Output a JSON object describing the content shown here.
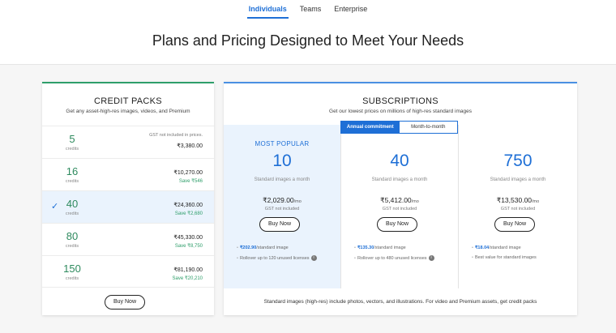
{
  "tabs": [
    {
      "label": "Individuals",
      "active": true
    },
    {
      "label": "Teams",
      "active": false
    },
    {
      "label": "Enterprise",
      "active": false
    }
  ],
  "page_title": "Plans and Pricing Designed to Meet Your Needs",
  "credit_packs": {
    "title": "CREDIT PACKS",
    "subtitle": "Get any asset-high-res images, videos, and Premium",
    "gst_note": "GST not included in prices.",
    "rows": [
      {
        "credits": "5",
        "unit": "credits",
        "price": "₹3,380.00",
        "save": "",
        "selected": false
      },
      {
        "credits": "16",
        "unit": "credits",
        "price": "₹10,270.00",
        "save": "Save ₹546",
        "selected": false
      },
      {
        "credits": "40",
        "unit": "credits",
        "price": "₹24,360.00",
        "save": "Save ₹2,680",
        "selected": true
      },
      {
        "credits": "80",
        "unit": "credits",
        "price": "₹45,330.00",
        "save": "Save ₹8,750",
        "selected": false
      },
      {
        "credits": "150",
        "unit": "credits",
        "price": "₹81,190.00",
        "save": "Save ₹20,210",
        "selected": false
      }
    ],
    "check": "✓",
    "buy_label": "Buy Now"
  },
  "subscriptions": {
    "title": "SUBSCRIPTIONS",
    "subtitle": "Get our lowest prices on millions of high-res standard images",
    "toggle": {
      "on": "Annual commitment",
      "off": "Month-to-month"
    },
    "plans": [
      {
        "popular": "MOST POPULAR",
        "count": "10",
        "desc": "Standard images a month",
        "price": "₹2,029.00",
        "per": "/mo",
        "gst": "GST not included",
        "buy_label": "Buy Now",
        "per_image": "₹202.90",
        "per_image_suffix": "/standard image",
        "feature": "Rollover up to 120 unused licenses"
      },
      {
        "popular": "",
        "count": "40",
        "desc": "Standard images a month",
        "price": "₹5,412.00",
        "per": "/mo",
        "gst": "GST not included",
        "buy_label": "Buy Now",
        "per_image": "₹135.30",
        "per_image_suffix": "/standard image",
        "feature": "Rollover up to 480 unused licenses"
      },
      {
        "popular": "",
        "count": "750",
        "desc": "Standard images a month",
        "price": "₹13,530.00",
        "per": "/mo",
        "gst": "GST not included",
        "buy_label": "Buy Now",
        "per_image": "₹18.04",
        "per_image_suffix": "/standard image",
        "feature": "Best value for standard images"
      }
    ],
    "bullet": "•",
    "info_icon": "i",
    "note": "Standard images (high-res) include photos, vectors, and illustrations. For video and Premium assets, get credit packs"
  },
  "colors": {
    "accent_blue": "#1e6fd6",
    "accent_green": "#2e9e6a"
  }
}
